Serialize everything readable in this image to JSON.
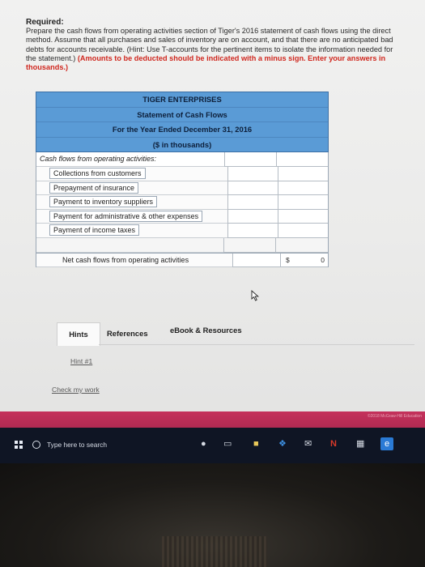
{
  "required": {
    "heading": "Required:",
    "instructions": "Prepare the cash flows from operating activities section of Tiger's 2016 statement of cash flows using the direct method. Assume that all purchases and sales of inventory are on account, and that there are no anticipated bad debts for accounts receivable. (Hint: Use T-accounts for the pertinent items to isolate the information needed for the statement.) ",
    "emphasis": "(Amounts to be deducted should be indicated with a minus sign. Enter your answers in thousands.)"
  },
  "statement": {
    "company": "TIGER ENTERPRISES",
    "title": "Statement of Cash Flows",
    "period": "For the Year Ended December 31, 2016",
    "units": "($ in thousands)",
    "section_label": "Cash flows from operating activities:",
    "items": [
      {
        "label": "Collections from customers",
        "value": ""
      },
      {
        "label": "Prepayment of insurance",
        "value": ""
      },
      {
        "label": "Payment to inventory suppliers",
        "value": ""
      },
      {
        "label": "Payment for administrative & other expenses",
        "value": ""
      },
      {
        "label": "Payment of income taxes",
        "value": ""
      }
    ],
    "total_label": "Net cash flows from operating activities",
    "total_currency": "$",
    "total_value": "0"
  },
  "tabs": {
    "hints": "Hints",
    "references": "References",
    "ebook": "eBook & Resources"
  },
  "links": {
    "hint1": "Hint #1",
    "check": "Check my work"
  },
  "footer": {
    "copyright": "©2018 McGraw-Hill Education"
  },
  "taskbar": {
    "search_placeholder": "Type here to search"
  }
}
